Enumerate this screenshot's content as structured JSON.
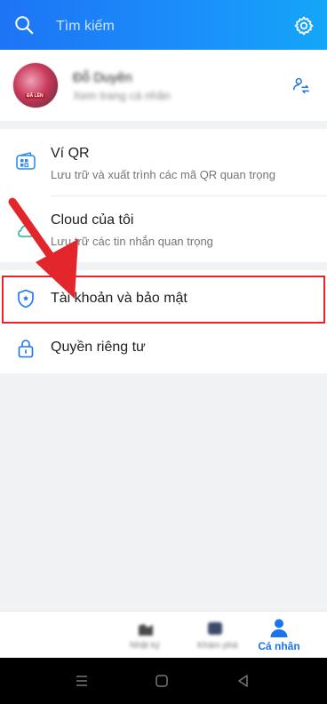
{
  "header": {
    "search_placeholder": "Tìm kiếm",
    "search_icon": "search-icon",
    "settings_icon": "gear-icon"
  },
  "profile": {
    "name": "Đỗ Duyên",
    "subtitle": "Xem trang cá nhân",
    "avatar_tag": "ĐÃ LÊN",
    "switch_icon": "switch-account-icon"
  },
  "menu": {
    "items": [
      {
        "title": "Ví QR",
        "subtitle": "Lưu trữ và xuất trình các mã QR quan trọng",
        "icon": "qr-wallet-icon"
      },
      {
        "title": "Cloud của tôi",
        "subtitle": "Lưu trữ các tin nhắn quan trọng",
        "icon": "cloud-icon"
      },
      {
        "title": "Tài khoản và bảo mật",
        "icon": "shield-icon"
      },
      {
        "title": "Quyền riêng tư",
        "icon": "lock-icon"
      }
    ]
  },
  "bottom_nav": {
    "active_label": "Cá nhân",
    "blurred_label_1": "Nhật ký",
    "blurred_label_2": "Khám phá"
  },
  "colors": {
    "accent": "#1a74f0",
    "header_start": "#1d74f5",
    "header_end": "#14a6f8",
    "highlight": "#e3262c"
  }
}
